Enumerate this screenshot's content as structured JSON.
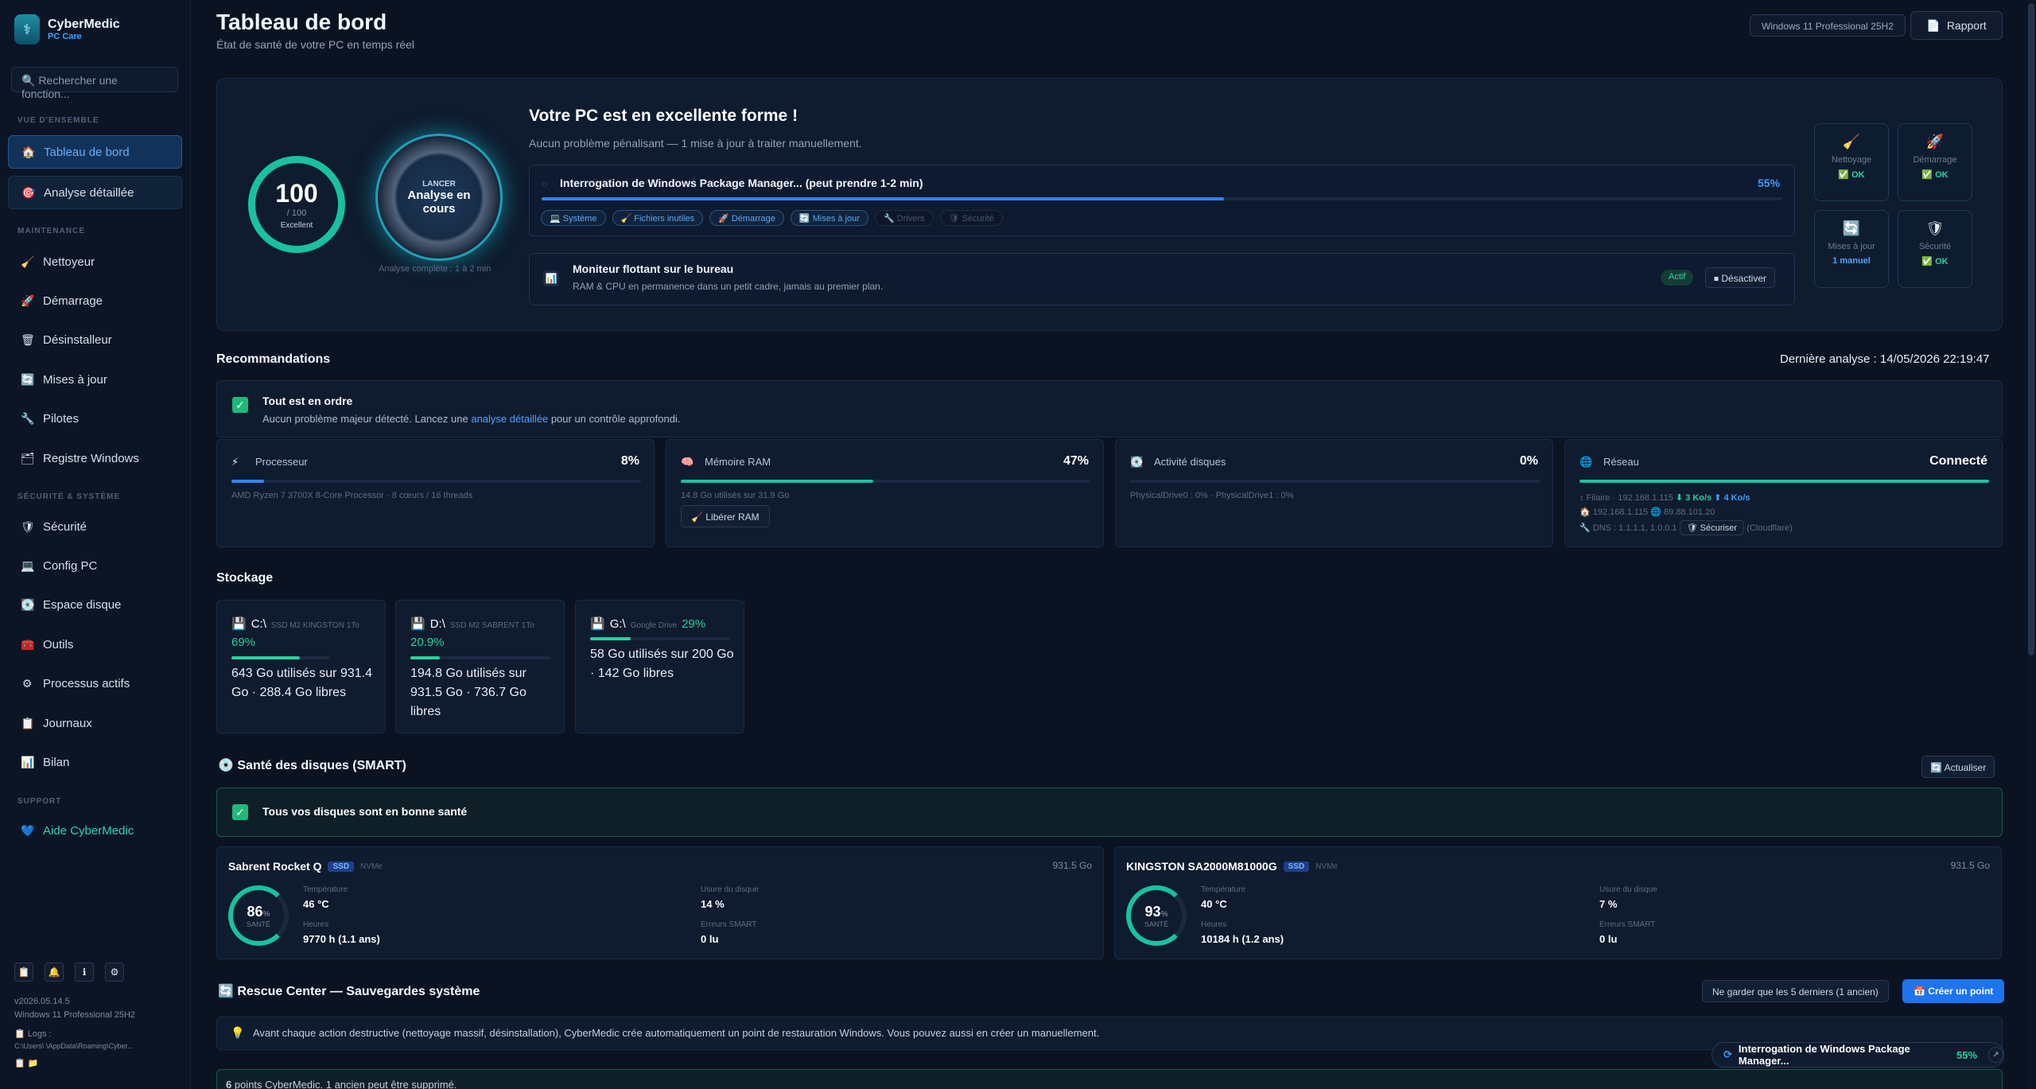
{
  "brand": {
    "name": "CyberMedic",
    "sub": "PC Care"
  },
  "search": {
    "placeholder": "🔍 Rechercher une fonction..."
  },
  "nav": {
    "section_overview": "VUE D'ENSEMBLE",
    "section_maintenance": "MAINTENANCE",
    "section_security": "SÉCURITÉ & SYSTÈME",
    "section_support": "SUPPORT",
    "items": [
      {
        "label": "Tableau de bord",
        "icon": "🏠"
      },
      {
        "label": "Analyse détaillée",
        "icon": "🎯"
      },
      {
        "label": "Nettoyeur",
        "icon": "🧹"
      },
      {
        "label": "Démarrage",
        "icon": "🚀"
      },
      {
        "label": "Désinstalleur",
        "icon": "🗑"
      },
      {
        "label": "Mises à jour",
        "icon": "🔄"
      },
      {
        "label": "Pilotes",
        "icon": "🔧"
      },
      {
        "label": "Registre Windows",
        "icon": "🗂"
      },
      {
        "label": "Sécurité",
        "icon": "🛡"
      },
      {
        "label": "Config PC",
        "icon": "💻"
      },
      {
        "label": "Espace disque",
        "icon": "💽"
      },
      {
        "label": "Outils",
        "icon": "🧰"
      },
      {
        "label": "Processus actifs",
        "icon": "⚙"
      },
      {
        "label": "Journaux",
        "icon": "📋"
      },
      {
        "label": "Bilan",
        "icon": "📊"
      },
      {
        "label": "Aide CyberMedic",
        "icon": "💙"
      }
    ],
    "bottom_icons": [
      "📋",
      "🔔",
      "ℹ",
      "⚙"
    ],
    "version": "v2026.05.14.5",
    "os": "Windows 11 Professional 25H2",
    "logs_label": "📋 Logs :",
    "logs_path": "C:\\Users\\        \\AppData\\Roaming\\Cyber..."
  },
  "header": {
    "title": "Tableau de bord",
    "subtitle": "État de santé de votre PC en temps réel",
    "os_pill": "Windows 11 Professional 25H2",
    "report_label": "Rapport",
    "report_icon": "📄"
  },
  "hero": {
    "score": "100",
    "score_max": "/ 100",
    "score_label": "Excellent",
    "launch_small": "LANCER",
    "launch_big": "Analyse en cours",
    "launch_note": "Analyse complète : 1 à 2 min",
    "title": "Votre PC est en excellente forme !",
    "subtitle": "Aucun problème pénalisant — 1 mise à jour à traiter manuellement.",
    "task": "Interrogation de Windows Package Manager... (peut prendre 1-2 min)",
    "task_pct": "55%",
    "task_progress": 0.55,
    "chips": [
      {
        "label": "💻 Système",
        "dim": false
      },
      {
        "label": "🧹 Fichiers inutiles",
        "dim": false
      },
      {
        "label": "🚀 Démarrage",
        "dim": false
      },
      {
        "label": "🔄 Mises à jour",
        "dim": false
      },
      {
        "label": "🔧 Drivers",
        "dim": true
      },
      {
        "label": "🛡 Sécurité",
        "dim": true
      }
    ],
    "monitor_title": "Moniteur flottant sur le bureau",
    "monitor_sub": "RAM & CPU en permanence dans un petit cadre, jamais au premier plan.",
    "monitor_badge": "Actif",
    "monitor_btn": "⏹ Désactiver",
    "minis": [
      {
        "label": "Nettoyage",
        "status": "✅ OK",
        "icon": "🧹"
      },
      {
        "label": "Démarrage",
        "status": "✅ OK",
        "icon": "🚀"
      },
      {
        "label": "Mises à jour",
        "status": "1 manuel",
        "icon": "🔄"
      },
      {
        "label": "Sécurité",
        "status": "✅ OK",
        "icon": "🛡"
      }
    ]
  },
  "reco": {
    "title": "Recommandations",
    "last_scan": "Dernière analyse : 14/05/2026 22:19:47",
    "ok_title": "Tout est en ordre",
    "ok_sub_pre": "Aucun problème majeur détecté. Lancez une ",
    "ok_sub_link": "analyse détaillée",
    "ok_sub_post": " pour un contrôle approfondi."
  },
  "stats": [
    {
      "name": "Processeur",
      "icon": "⚡",
      "value": "8%",
      "progress": 0.08,
      "color": "#2f86ff",
      "note": "AMD Ryzen 7 3700X 8-Core Processor · 8 cœurs / 16 threads"
    },
    {
      "name": "Mémoire RAM",
      "icon": "🧠",
      "value": "47%",
      "progress": 0.47,
      "color": "#17c29f",
      "note": "14.8 Go utilisés sur 31.9 Go",
      "button": "🧹 Libérer RAM"
    },
    {
      "name": "Activité disques",
      "icon": "💽",
      "value": "0%",
      "progress": 0.0,
      "color": "#17c29f",
      "note": "PhysicalDrive0 : 0% · PhysicalDrive1 : 0%"
    },
    {
      "name": "Réseau",
      "icon": "🌐",
      "value": "Connecté",
      "progress": 1.0,
      "color": "#17c29f",
      "line1": "↕ Filaire · 192.168.1.115",
      "down": "⬇ 3 Ko/s",
      "up": "⬆ 4 Ko/s",
      "line2": "🏠 192.168.1.115  🌐 89.88.101.20",
      "line3": "🔧 DNS : 1.1.1.1, 1.0.0.1",
      "secure": "🛡 Sécuriser",
      "line3_post": "(Cloudflare)"
    }
  ],
  "storage": {
    "title": "Stockage",
    "drives": [
      {
        "letter": "C:\\",
        "type": "SSD M2 KINGSTON 1To",
        "pct": "69%",
        "progress": 0.69,
        "text": "643 Go utilisés sur 931.4 Go · 288.4 Go libres"
      },
      {
        "letter": "D:\\",
        "type": "SSD M2 SABRENT 1To",
        "pct": "20.9%",
        "progress": 0.209,
        "text": "194.8 Go utilisés sur 931.5 Go · 736.7 Go libres"
      },
      {
        "letter": "G:\\",
        "type": "Google Drive",
        "pct": "29%",
        "progress": 0.29,
        "text": "58 Go utilisés sur 200 Go · 142 Go libres"
      }
    ]
  },
  "smart": {
    "title": "💿 Santé des disques (SMART)",
    "refresh": "🔄 Actualiser",
    "ok_title": "Tous vos disques sont en bonne santé",
    "disks": [
      {
        "name": "Sabrent Rocket Q",
        "kind": "SSD",
        "bus": "NVMe",
        "size": "931.5 Go",
        "health": "86",
        "health_unit": "%",
        "health_label": "SANTÉ",
        "temp_label": "Température",
        "temp": "46 °C",
        "hours_label": "Heures",
        "hours": "9770 h (1.1 ans)",
        "wear_label": "Usure du disque",
        "wear": "14 %",
        "err_label": "Erreurs SMART",
        "err": "0 lu"
      },
      {
        "name": "KINGSTON SA2000M81000G",
        "kind": "SSD",
        "bus": "NVMe",
        "size": "931.5 Go",
        "health": "93",
        "health_unit": "%",
        "health_label": "SANTÉ",
        "temp_label": "Température",
        "temp": "40 °C",
        "hours_label": "Heures",
        "hours": "10184 h (1.2 ans)",
        "wear_label": "Usure du disque",
        "wear": "7 %",
        "err_label": "Erreurs SMART",
        "err": "0 lu"
      }
    ]
  },
  "rescue": {
    "title": "🔄 Rescue Center — Sauvegardes système",
    "keep_btn": "Ne garder que les 5 derniers (1 ancien)",
    "create_btn": "📅 Créer un point",
    "info": "Avant chaque action destructive (nettoyage massif, désinstallation), CyberMedic crée automatiquement un point de restauration Windows. Vous pouvez aussi en créer un manuellement.",
    "info_icon": "💡",
    "count_num": "6",
    "count_text": " points CyberMedic. 1 ancien peut être supprimé."
  },
  "toast": {
    "text": "Interrogation de Windows Package Manager...",
    "pct": "55%",
    "icon": "⟳",
    "collapse": "↗"
  }
}
